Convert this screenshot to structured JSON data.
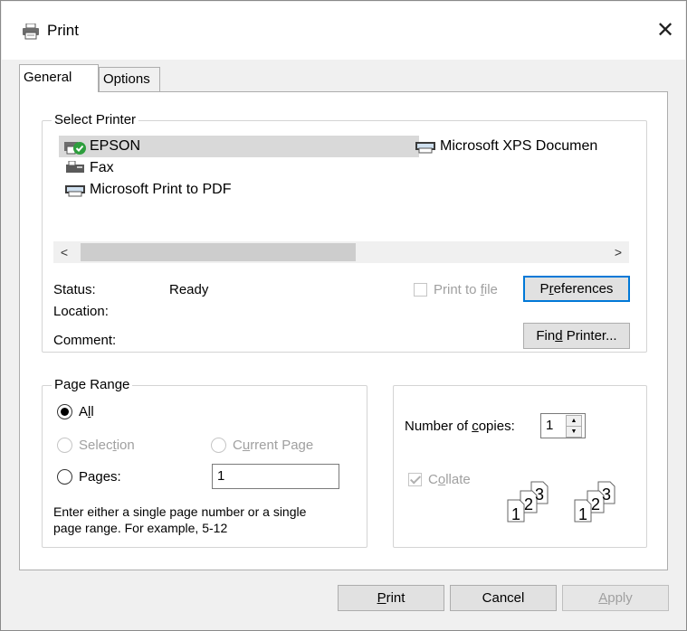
{
  "window": {
    "title": "Print",
    "close_glyph": "✕"
  },
  "tabs": [
    {
      "label": "General",
      "active": true
    },
    {
      "label": "Options",
      "active": false
    }
  ],
  "select_printer": {
    "legend": "Select Printer",
    "printers": [
      {
        "name": "EPSON",
        "selected": true,
        "icon": "printer-default-icon"
      },
      {
        "name": "Fax",
        "selected": false,
        "icon": "fax-icon"
      },
      {
        "name": "Microsoft Print to PDF",
        "selected": false,
        "icon": "printer-icon"
      },
      {
        "name": "Microsoft XPS Documen",
        "selected": false,
        "icon": "printer-icon"
      }
    ],
    "scroll_left": "<",
    "scroll_right": ">",
    "status_label": "Status:",
    "status_value": "Ready",
    "location_label": "Location:",
    "comment_label": "Comment:",
    "print_to_file": {
      "pre": "Print to ",
      "key": "f",
      "post": "ile",
      "checked": false,
      "enabled": false
    },
    "preferences": {
      "pre": "P",
      "key": "r",
      "post": "eferences"
    },
    "find_printer": {
      "pre": "Fin",
      "key": "d",
      "post": " Printer..."
    }
  },
  "page_range": {
    "legend": "Page Range",
    "all": {
      "pre": "A",
      "key": "l",
      "post": "l",
      "checked": true
    },
    "selection": {
      "pre": "Selec",
      "key": "t",
      "post": "ion",
      "enabled": false
    },
    "current_page": {
      "pre": "C",
      "key": "u",
      "post": "rrent Page",
      "enabled": false
    },
    "pages": {
      "pre": "Pa",
      "key": "g",
      "post": "es:",
      "checked": false
    },
    "pages_value": "1",
    "hint_line1": "Enter either a single page number or a single",
    "hint_line2": "page range.  For example, 5-12"
  },
  "copies": {
    "label": {
      "pre": "Number of ",
      "key": "c",
      "post": "opies:"
    },
    "value": "1",
    "collate": {
      "pre": "C",
      "key": "o",
      "post": "llate",
      "checked": true,
      "enabled": false
    },
    "collate_icon_numbers": [
      "1",
      "2",
      "3"
    ]
  },
  "buttons": {
    "print": {
      "pre": "",
      "key": "P",
      "post": "rint"
    },
    "cancel": "Cancel",
    "apply": {
      "pre": "",
      "key": "A",
      "post": "pply"
    }
  },
  "colors": {
    "focus_border": "#0078d7",
    "selection_bg": "#d9d9d9",
    "default_badge": "#2e9e3e"
  }
}
